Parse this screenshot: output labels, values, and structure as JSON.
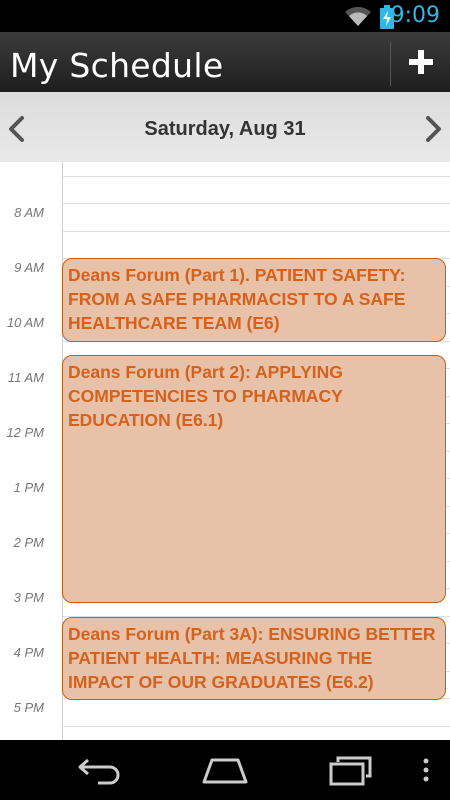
{
  "status_bar": {
    "time": "9:09",
    "icons": [
      "wifi-icon",
      "battery-charging-icon"
    ]
  },
  "action_bar": {
    "title": "My Schedule",
    "add_icon": "plus-icon"
  },
  "date_nav": {
    "date": "Saturday, Aug 31",
    "prev_icon": "chevron-left-icon",
    "next_icon": "chevron-right-icon"
  },
  "time_labels": [
    "8 AM",
    "9 AM",
    "10 AM",
    "11 AM",
    "12 PM",
    "1 PM",
    "2 PM",
    "3 PM",
    "4 PM",
    "5 PM"
  ],
  "events": [
    {
      "title": "Deans Forum (Part 1). PATIENT SAFETY: FROM A SAFE PHARMACIST TO A SAFE HEALTHCARE TEAM (E6)"
    },
    {
      "title": "Deans Forum (Part 2): APPLYING COMPETENCIES TO PHARMACY EDUCATION (E6.1)"
    },
    {
      "title": "Deans Forum (Part 3A): ENSURING BETTER PATIENT HEALTH: MEASURING THE IMPACT OF OUR GRADUATES (E6.2)"
    }
  ],
  "colors": {
    "event_fill": "#e8c1a9",
    "event_border": "#c65e1a",
    "event_text": "#d4621c",
    "clock": "#33b5e5"
  },
  "nav_bar": {
    "icons": [
      "back-icon",
      "home-icon",
      "recent-apps-icon",
      "overflow-menu-icon"
    ]
  }
}
